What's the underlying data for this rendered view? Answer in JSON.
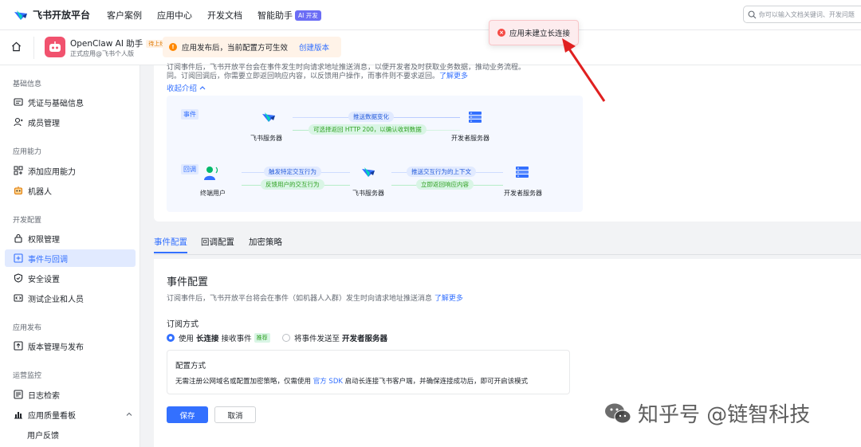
{
  "topnav": {
    "brand": "飞书开放平台",
    "items": [
      "客户案例",
      "应用中心",
      "开发文档",
      "智能助手"
    ],
    "ai_badge": "AI 开发",
    "search_placeholder": "你可以输入文档关键词、开发问题"
  },
  "app": {
    "name": "OpenClaw AI 助手",
    "status": "待上线",
    "subtitle": "正式应用@飞书个人版"
  },
  "notice": {
    "text": "应用发布后，当前配置方可生效",
    "link": "创建版本"
  },
  "toast": {
    "text": "应用未建立长连接"
  },
  "sidebar": {
    "groups": [
      {
        "title": "基础信息",
        "items": [
          "凭证与基础信息",
          "成员管理"
        ]
      },
      {
        "title": "应用能力",
        "items": [
          "添加应用能力",
          "机器人"
        ]
      },
      {
        "title": "开发配置",
        "items": [
          "权限管理",
          "事件与回调",
          "安全设置",
          "测试企业和人员"
        ]
      },
      {
        "title": "应用发布",
        "items": [
          "版本管理与发布"
        ]
      },
      {
        "title": "运营监控",
        "items": [
          "日志检索",
          "应用质量看板",
          "用户反馈"
        ]
      }
    ]
  },
  "intro": {
    "line1": "订阅事件后，飞书开放平台会在事件发生时向请求地址推送消息，以便开发者及时获取业务数据，推动业务流程。",
    "line2_prefix": "同。订阅回调后，你需要立即返回响应内容，以反馈用户操作，而事件则不要求返回。",
    "learn_more": "了解更多",
    "collapse": "收起介绍"
  },
  "diagram": {
    "event_tag": "事件",
    "callback_tag": "回调",
    "feishu_server": "飞书服务器",
    "dev_server": "开发者服务器",
    "end_user": "终端用户",
    "push_data": "推送数据变化",
    "return_200": "可选择返回 HTTP 200，以确认收到数据",
    "trigger": "触发特定交互行为",
    "feedback": "反馈用户的交互行为",
    "push_context": "推送交互行为的上下文",
    "return_resp": "立即返回响应内容"
  },
  "tabs": [
    "事件配置",
    "回调配置",
    "加密策略"
  ],
  "event_config": {
    "title": "事件配置",
    "desc": "订阅事件后，飞书开放平台将会在事件（如机器人入群）发生时向请求地址推送消息",
    "learn_more": "了解更多",
    "sub_title": "订阅方式",
    "option1_prefix": "使用",
    "option1_bold": "长连接",
    "option1_suffix": "接收事件",
    "option1_badge": "推荐",
    "option2_prefix": "将事件发送至",
    "option2_bold": "开发者服务器",
    "cfg_title": "配置方式",
    "cfg_desc_prefix": "无需注册公网域名或配置加密策略，仅需使用",
    "cfg_link": "官方 SDK",
    "cfg_desc_suffix": "启动长连接飞书客户端，并确保连接成功后，即可开启该模式",
    "save": "保存",
    "cancel": "取消"
  },
  "watermark": "知乎号 @链智科技",
  "colors": {
    "primary": "#3370ff",
    "danger": "#f54a45",
    "warning": "#ff8800",
    "success": "#2ea121"
  }
}
